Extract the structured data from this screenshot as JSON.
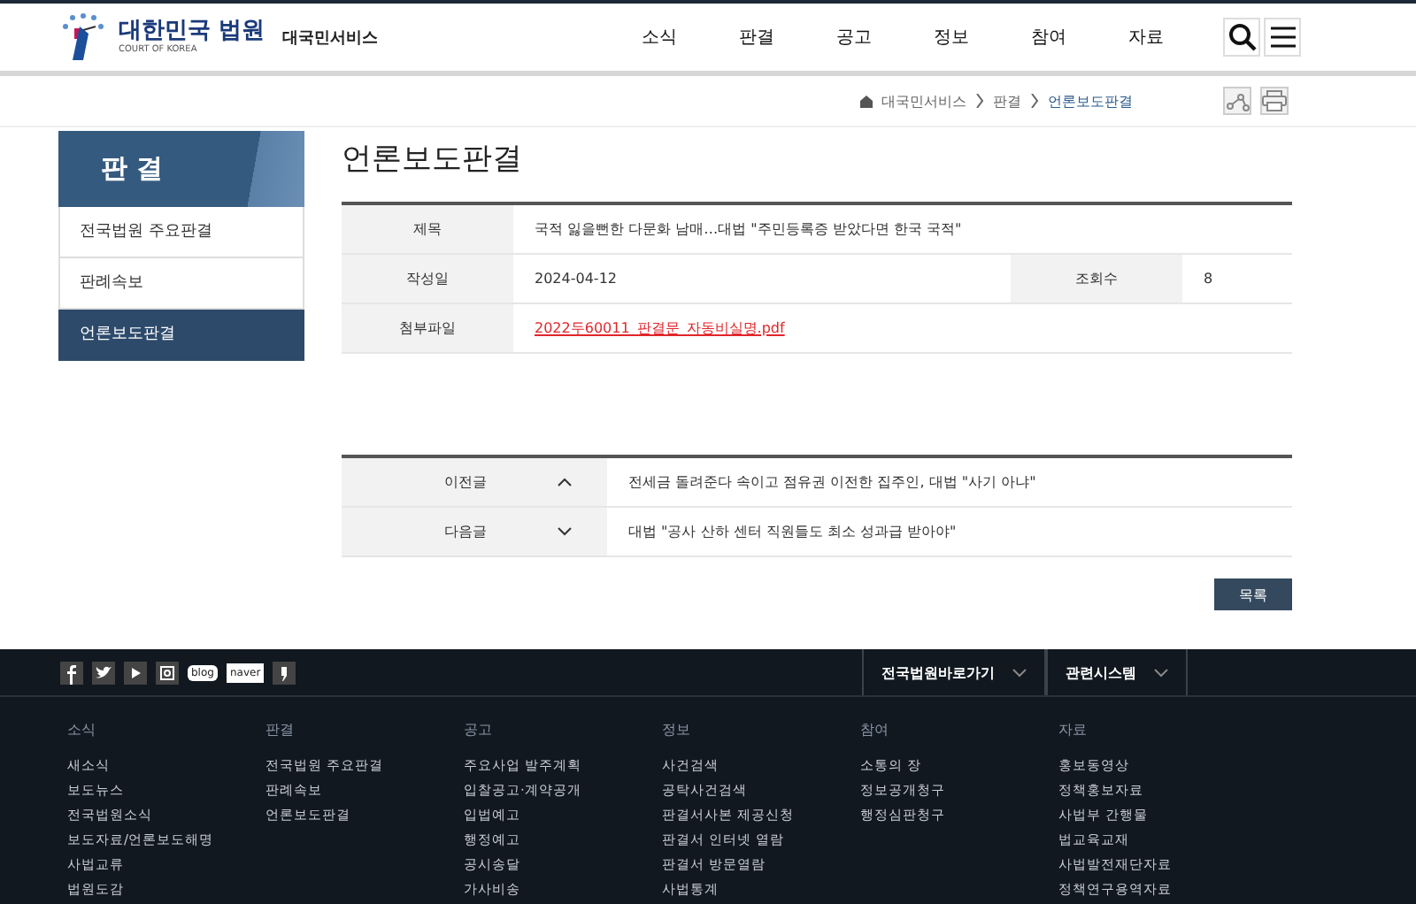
{
  "header": {
    "logo_title": "대한민국 법원",
    "logo_subtitle": "COURT OF KOREA",
    "service_name": "대국민서비스",
    "nav": [
      {
        "label": "소식"
      },
      {
        "label": "판결"
      },
      {
        "label": "공고"
      },
      {
        "label": "정보"
      },
      {
        "label": "참여"
      },
      {
        "label": "자료"
      }
    ]
  },
  "breadcrumb": [
    "대국민서비스",
    "판결",
    "언론보도판결"
  ],
  "sidebar": {
    "title": "판 결",
    "items": [
      {
        "label": "전국법원 주요판결",
        "selected": false
      },
      {
        "label": "판례속보",
        "selected": false
      },
      {
        "label": "언론보도판결",
        "selected": true
      }
    ]
  },
  "page_title": "언론보도판결",
  "article": {
    "title_label": "제목",
    "title": "국적 잃을뻔한 다문화 남매…대법 \"주민등록증 받았다면 한국 국적\"",
    "date_label": "작성일",
    "date": "2024-04-12",
    "views_label": "조회수",
    "views": "8",
    "attachment_label": "첨부파일",
    "attachment": "2022두60011_판결문_자동비실명.pdf"
  },
  "prev_next": [
    {
      "kind": "prev",
      "label": "이전글",
      "text": "전세금 돌려준다 속이고 점유권 이전한 집주인, 대법 \"사기 아냐\""
    },
    {
      "kind": "next",
      "label": "다음글",
      "text": "대법 \"공사 산하 센터 직원들도 최소 성과급 받아야\""
    }
  ],
  "list_button": "목록",
  "footer": {
    "social": [
      {
        "kind": "facebook"
      },
      {
        "kind": "twitter"
      },
      {
        "kind": "youtube"
      },
      {
        "kind": "instagram"
      },
      {
        "kind": "blog",
        "text": "blog"
      },
      {
        "kind": "naver",
        "text": "naver"
      },
      {
        "kind": "kakao"
      }
    ],
    "dropdowns": [
      "전국법원바로가기",
      "관련시스템"
    ],
    "columns": [
      {
        "heading": "소식",
        "links": [
          "새소식",
          "보도뉴스",
          "전국법원소식",
          "보도자료/언론보도해명",
          "사법교류",
          "법원도감"
        ]
      },
      {
        "heading": "판결",
        "links": [
          "전국법원 주요판결",
          "판례속보",
          "언론보도판결"
        ]
      },
      {
        "heading": "공고",
        "links": [
          "주요사업 발주계획",
          "입찰공고·계약공개",
          "입법예고",
          "행정예고",
          "공시송달",
          "가사비송"
        ]
      },
      {
        "heading": "정보",
        "links": [
          "사건검색",
          "공탁사건검색",
          "판결서사본 제공신청",
          "판결서 인터넷 열람",
          "판결서 방문열람",
          "사법통계"
        ]
      },
      {
        "heading": "참여",
        "links": [
          "소통의 장",
          "정보공개청구",
          "행정심판청구"
        ]
      },
      {
        "heading": "자료",
        "links": [
          "홍보동영상",
          "정책홍보자료",
          "사법부 간행물",
          "법교육교재",
          "사법발전재단자료",
          "정책연구용역자료"
        ]
      }
    ]
  }
}
